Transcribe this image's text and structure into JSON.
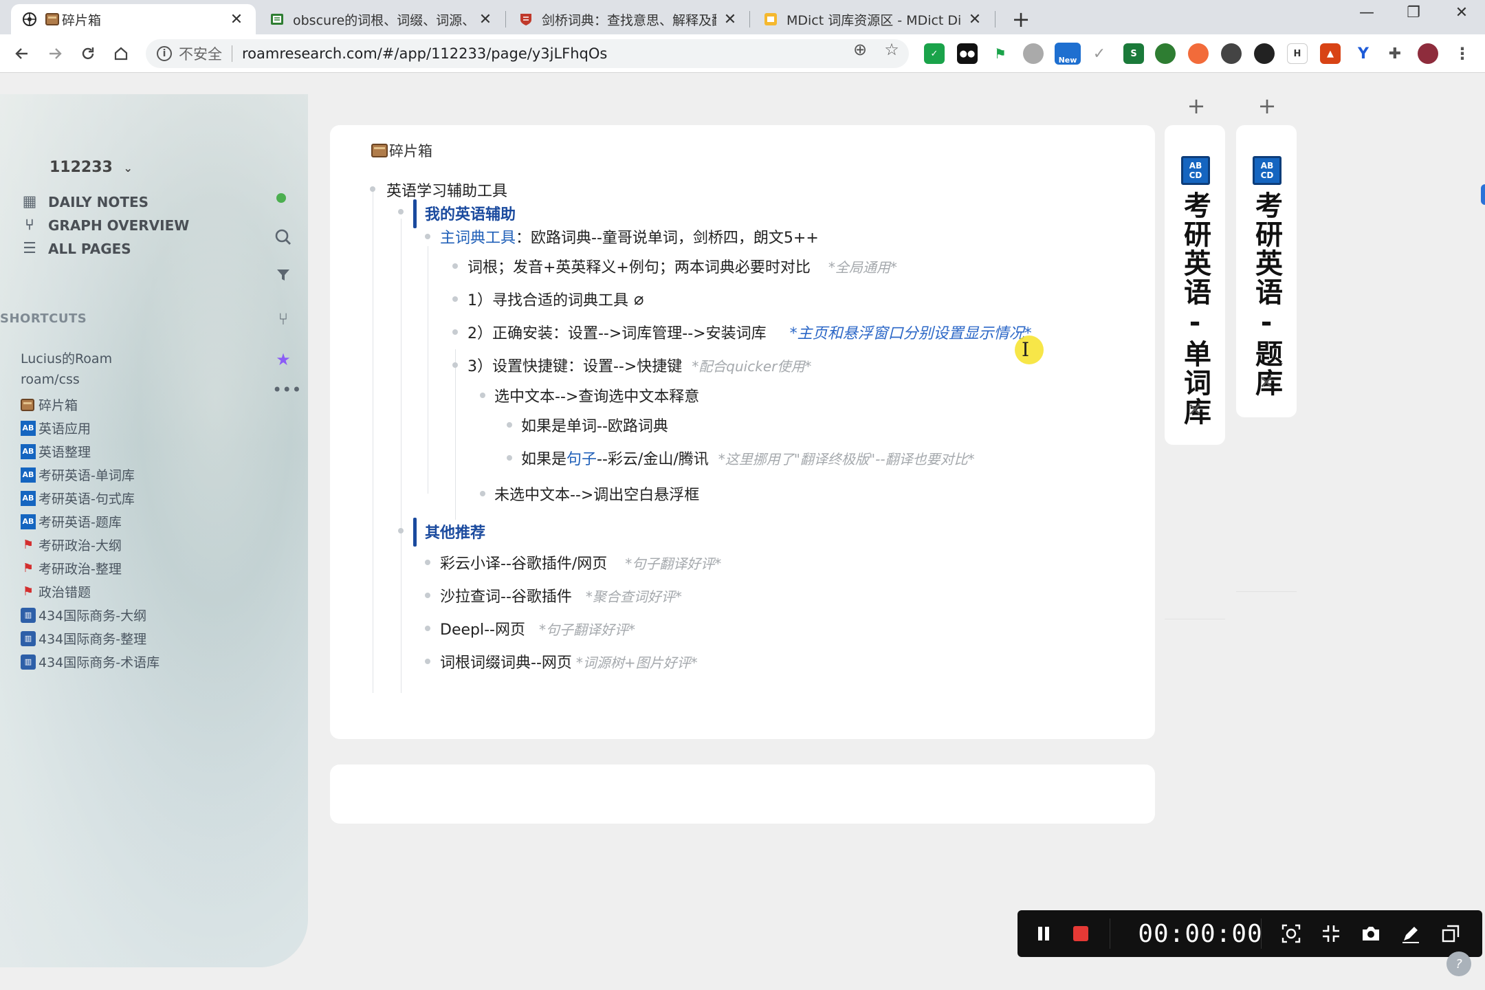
{
  "browser": {
    "tabs": [
      {
        "title": "碎片箱",
        "close": "✕"
      },
      {
        "title": "obscure的词根、词缀、词源、记",
        "close": "✕"
      },
      {
        "title": "剑桥词典：查找意思、解释及翻译",
        "close": "✕"
      },
      {
        "title": "MDict 词库资源区 - MDict Dicti",
        "close": "✕"
      }
    ],
    "new_tab": "+",
    "window": {
      "minimize": "—",
      "restore": "❐",
      "close": "✕"
    },
    "insecure_label": "不安全",
    "url": "roamresearch.com/#/app/112233/page/y3jLFhqOs",
    "ext_new_badge": "New"
  },
  "sidebar": {
    "graph_name": "112233",
    "nav": [
      {
        "label": "DAILY NOTES",
        "icon": "calendar-icon"
      },
      {
        "label": "GRAPH OVERVIEW",
        "icon": "graph-icon"
      },
      {
        "label": "ALL PAGES",
        "icon": "list-icon"
      }
    ],
    "shortcuts_label": "SHORTCUTS",
    "shortcuts": [
      {
        "label": "Lucius的Roam",
        "icon": "none"
      },
      {
        "label": "roam/css",
        "icon": "none"
      },
      {
        "label": "碎片箱",
        "icon": "box-icon"
      },
      {
        "label": "英语应用",
        "icon": "abcd-icon"
      },
      {
        "label": "英语整理",
        "icon": "abcd-icon"
      },
      {
        "label": "考研英语-单词库",
        "icon": "abcd-icon"
      },
      {
        "label": "考研英语-句式库",
        "icon": "abcd-icon"
      },
      {
        "label": "考研英语-题库",
        "icon": "abcd-icon"
      },
      {
        "label": "考研政治-大纲",
        "icon": "flag-icon"
      },
      {
        "label": "考研政治-整理",
        "icon": "flag-icon"
      },
      {
        "label": "政治错题",
        "icon": "flag-icon"
      },
      {
        "label": "434国际商务-大纲",
        "icon": "building-icon"
      },
      {
        "label": "434国际商务-整理",
        "icon": "building-icon"
      },
      {
        "label": "434国际商务-术语库",
        "icon": "building-icon"
      }
    ]
  },
  "main": {
    "page_title": "碎片箱",
    "blocks": {
      "b1": "英语学习辅助工具",
      "b2": "我的英语辅助",
      "b3_link": "主词典工具",
      "b3_text": "：欧路词典--童哥说单词，剑桥四，朗文5++",
      "b4_text": "词根；发音+英英释义+例句；两本词典必要时对比",
      "b4_note": "*全局通用*",
      "b5_text": "1）寻找合适的词典工具",
      "b6_text": "2）正确安装：设置-->词库管理-->安装词库",
      "b6_note": "*主页和悬浮窗口分别设置显示情况*",
      "b7_text": "3）设置快捷键：设置-->快捷键",
      "b7_note": "*配合quicker使用*",
      "b8_text": "选中文本-->查询选中文本释意",
      "b9_text": "如果是单词--欧路词典",
      "b10_pre": "如果是",
      "b10_link": "句子",
      "b10_post": "--彩云/金山/腾讯",
      "b10_note": "*这里挪用了\"翻译终极版\"--翻译也要对比*",
      "b11_text": "未选中文本-->调出空白悬浮框",
      "b12": "其他推荐",
      "b13_text": "彩云小译--谷歌插件/网页",
      "b13_note": "*句子翻译好评*",
      "b14_text": "沙拉查词--谷歌插件",
      "b14_note": "*聚合查词好评*",
      "b15_text": "Deepl--网页",
      "b15_note": "*句子翻译好评*",
      "b16_text": "词根词缀词典--网页",
      "b16_note": "*词源树+图片好评*"
    }
  },
  "right_sidebar": {
    "cards": [
      {
        "title": "考研英语-单词库",
        "icon_text": "AB CD",
        "close": "✕"
      },
      {
        "title": "考研英语-题库",
        "icon_text": "AB CD",
        "close": "✕"
      }
    ],
    "plus": "+"
  },
  "recorder": {
    "time": "00:00:00"
  },
  "help_label": "?"
}
